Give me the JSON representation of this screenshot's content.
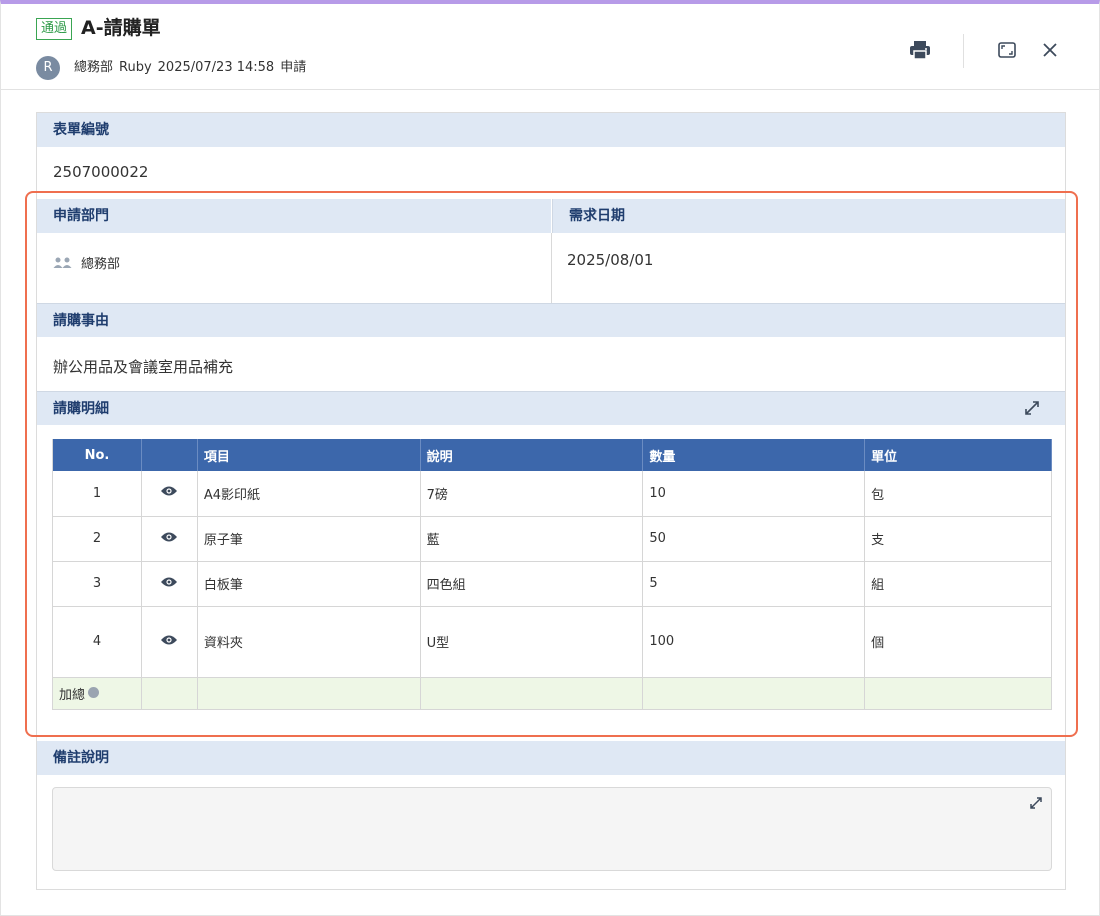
{
  "header": {
    "status": "通過",
    "title": "A-請購單",
    "avatar_initial": "R",
    "department": "總務部",
    "user": "Ruby",
    "datetime": "2025/07/23 14:58",
    "action": "申請"
  },
  "form": {
    "form_no_label": "表單編號",
    "form_no_value": "2507000022",
    "dept_label": "申請部門",
    "dept_value": "總務部",
    "date_label": "需求日期",
    "date_value": "2025/08/01",
    "reason_label": "請購事由",
    "reason_value": "辦公用品及會議室用品補充",
    "details_label": "請購明細",
    "remarks_label": "備註說明",
    "remarks_value": ""
  },
  "table": {
    "headers": [
      "No.",
      "",
      "項目",
      "說明",
      "數量",
      "單位"
    ],
    "rows": [
      {
        "no": "1",
        "item": "A4影印紙",
        "desc": "7磅",
        "qty": "10",
        "unit": "包"
      },
      {
        "no": "2",
        "item": "原子筆",
        "desc": "藍",
        "qty": "50",
        "unit": "支"
      },
      {
        "no": "3",
        "item": "白板筆",
        "desc": "四色組",
        "qty": "5",
        "unit": "組"
      },
      {
        "no": "4",
        "item": "資料夾",
        "desc": "U型",
        "qty": "100",
        "unit": "個"
      }
    ],
    "total_label": "加總"
  },
  "colors": {
    "accent_top": "#b79be8",
    "status_green": "#2e9a48",
    "section_bg": "#dfe8f4",
    "table_header": "#3c67ab",
    "highlight": "#ef6f4f"
  }
}
